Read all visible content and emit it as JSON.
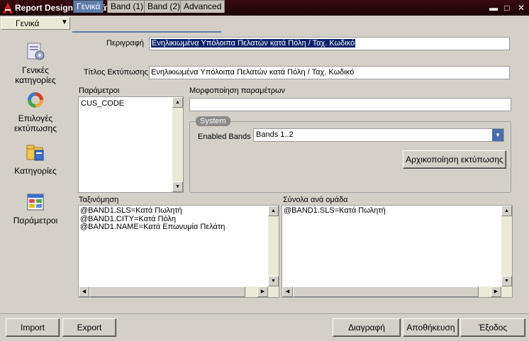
{
  "window": {
    "title": "Report Designer [Πελάτες]",
    "min_glyph": "▬",
    "max_glyph": "□",
    "close_glyph": "✕",
    "accent": "#5e7ea8",
    "titlebar_color": "#2a060b"
  },
  "sidebar": {
    "select_value": "Γενικά",
    "select_arrow": "▼",
    "items": [
      {
        "label": "Γενικές κατηγορίες",
        "icon": "general-categories-icon"
      },
      {
        "label": "Επιλογές εκτύπωσης",
        "icon": "print-options-icon"
      },
      {
        "label": "Κατηγορίες",
        "icon": "categories-icon"
      },
      {
        "label": "Παράμετροι",
        "icon": "parameters-icon"
      }
    ]
  },
  "tabs": [
    {
      "label": "Γενικά",
      "active": true
    },
    {
      "label": "Band (1)",
      "active": false
    },
    {
      "label": "Band (2)",
      "active": false
    },
    {
      "label": "Advanced",
      "active": false
    }
  ],
  "form": {
    "description_label": "Περιγραφή",
    "description_value": "Ενηλικιωμένα Υπόλοιπα Πελατών κατά Πόλη / Ταχ. Κωδικό",
    "print_title_label": "Τίτλος Εκτύπωσης",
    "print_title_value": "Ενηλικιωμένα Υπόλοιπα Πελατών κατά Πόλη / Ταχ. Κωδικό",
    "parameters_label": "Παράμετροι",
    "parameters_items": [
      "CUS_CODE"
    ],
    "param_format_label": "Μορφοποίηση παραμέτρων",
    "param_format_value": "",
    "system_group_title": "System",
    "enabled_bands_label": "Enabled Bands",
    "enabled_bands_value": "Bands 1..2",
    "reset_print_button": "Αρχικοποίηση εκτύπωσης",
    "sorting_label": "Ταξινόμηση",
    "sorting_items": [
      "@BAND1.SLS=Κατά Πωλητή",
      "@BAND1.CITY=Κατά Πόλη",
      "@BAND1.NAME=Κατά Επωνυμία Πελάτη"
    ],
    "group_totals_label": "Σύνολα ανά ομάδα",
    "group_totals_items": [
      "@BAND1.SLS=Κατά Πωλητή"
    ]
  },
  "scroll": {
    "up": "▲",
    "down": "▼",
    "left": "◀",
    "right": "▶"
  },
  "buttons": {
    "import": "Import",
    "export": "Export",
    "delete": "Διαγραφή",
    "save": "Αποθήκευση",
    "exit": "Έξοδος"
  }
}
